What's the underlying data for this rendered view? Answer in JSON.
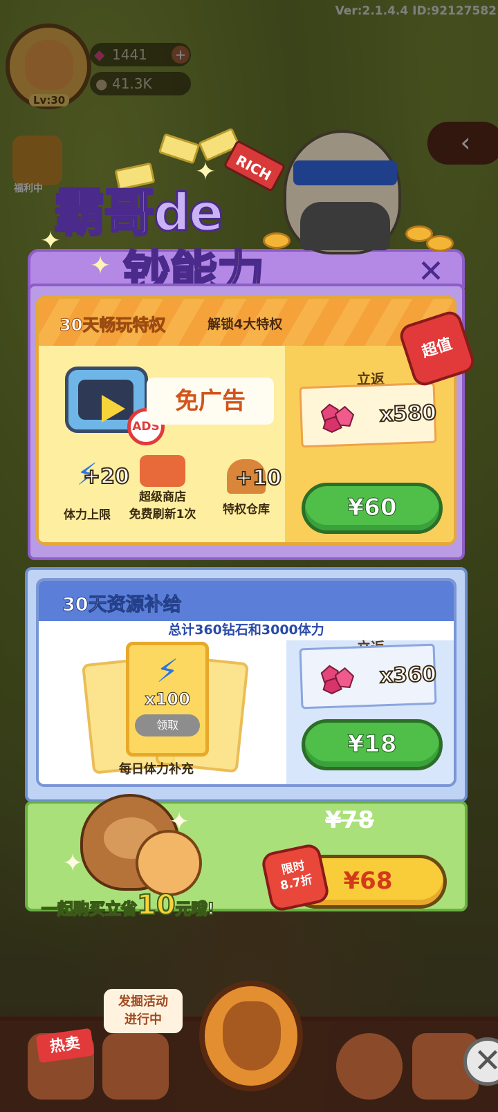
{
  "version_text": "Ver:2.1.4.4 ID:92127582",
  "player": {
    "level": "Lv:30",
    "diamonds": "1441",
    "acorns": "41.3K"
  },
  "side": {
    "welfare_label": "福利中"
  },
  "popup": {
    "title_line1": "霸哥de",
    "title_line2": "钞能力",
    "rich_label": "RICH",
    "pack1": {
      "heading": "30天畅玩特权",
      "subheading": "解锁4大特权",
      "no_ads_label": "免广告",
      "no_ads_badge": "ADS",
      "perks": [
        {
          "amount": "+20",
          "label": "体力上限"
        },
        {
          "amount": "超级商店",
          "label": "免费刷新1次"
        },
        {
          "amount": "+10",
          "label": "特权仓库"
        }
      ],
      "instant_label": "立返",
      "gem_amount": "x580",
      "price": "¥60",
      "value_tag": "超值"
    },
    "pack2": {
      "heading": "30天资源补给",
      "summary": "总计360钻石和3000体力",
      "card_amount": "x100",
      "claim_label": "领取",
      "daily_label": "每日体力补充",
      "instant_label": "立返",
      "gem_amount": "x360",
      "price": "¥18"
    },
    "bundle": {
      "promo_prefix": "一起购买立省",
      "promo_number": "10",
      "promo_suffix": "元哦!",
      "old_price": "¥78",
      "price": "¥68",
      "discount_line1": "限时",
      "discount_line2": "8.7折"
    }
  },
  "bottom": {
    "hot_label": "热卖",
    "event_line1": "发掘活动",
    "event_line2": "进行中"
  },
  "colors": {
    "purple": "#8e5cc8",
    "orange": "#f5a23a",
    "blue_header": "#5b7fd9",
    "green_button": "#4fbf4a",
    "green_panel": "#a9e07a"
  }
}
